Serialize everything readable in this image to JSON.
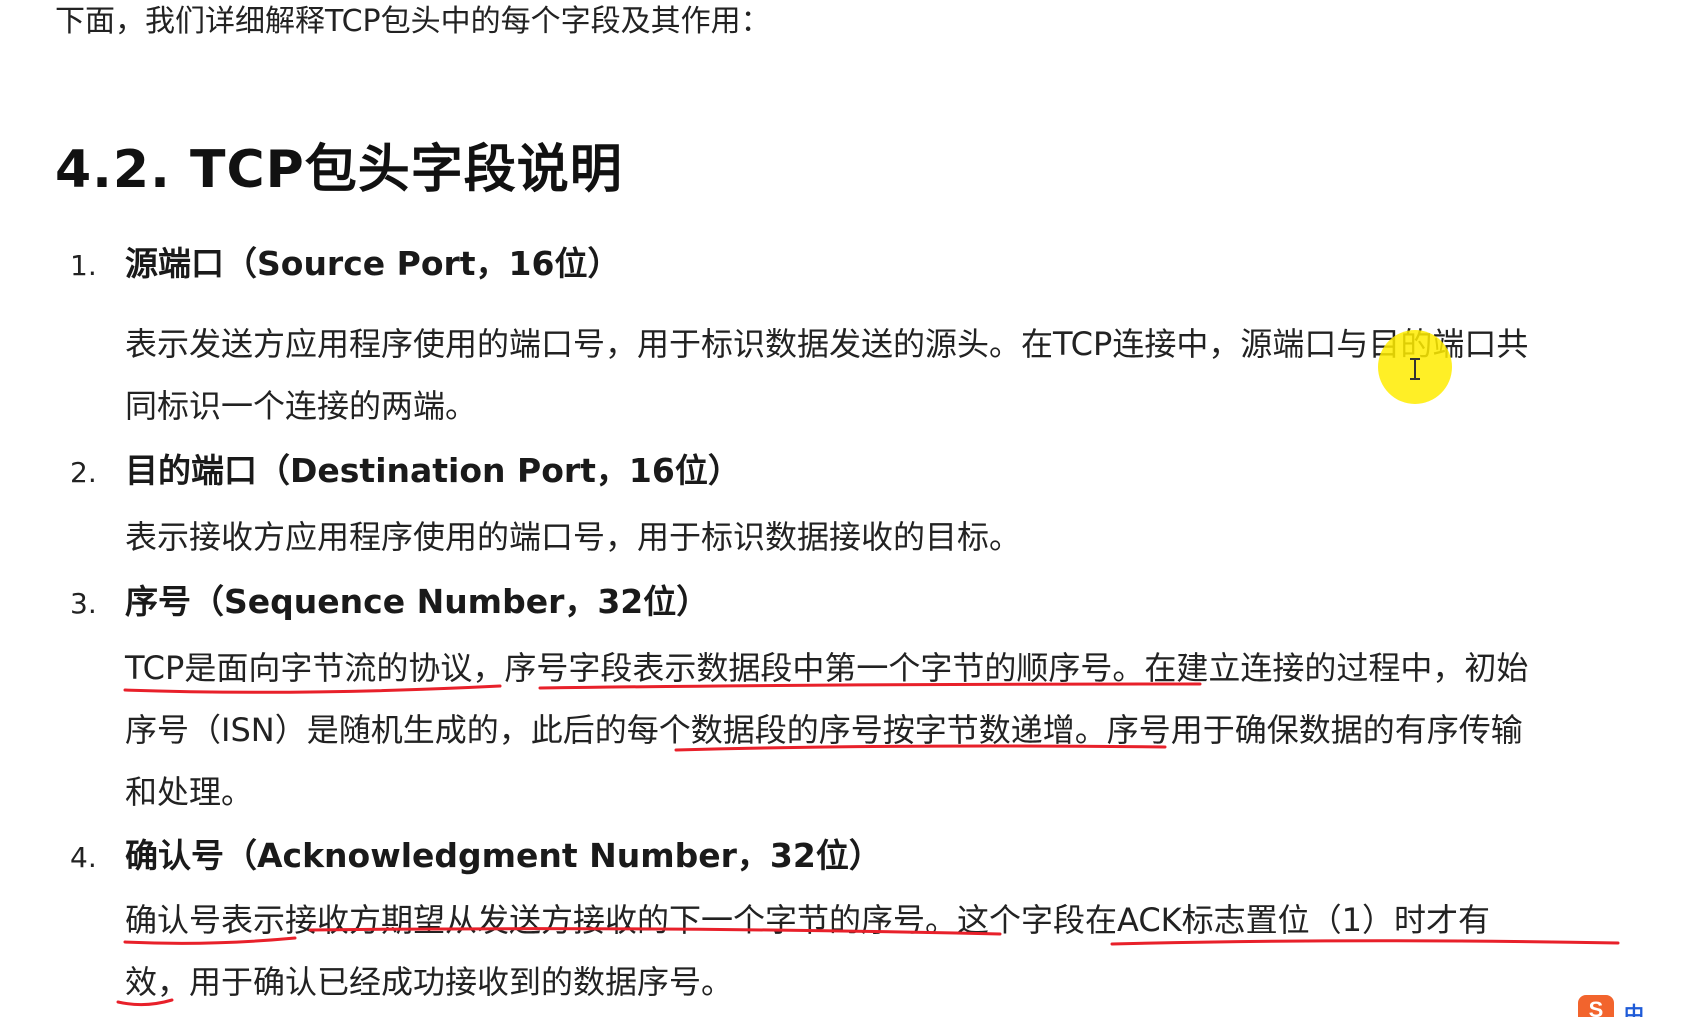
{
  "intro": "下面，我们详细解释TCP包头中的每个字段及其作用：",
  "heading": "4.2. TCP包头字段说明",
  "items": [
    {
      "num": "1.",
      "title": "源端口（Source Port，16位）",
      "lines": [
        "表示发送方应用程序使用的端口号，用于标识数据发送的源头。在TCP连接中，源端口与目的端口共",
        "同标识一个连接的两端。"
      ]
    },
    {
      "num": "2.",
      "title": "目的端口（Destination Port，16位）",
      "lines": [
        "表示接收方应用程序使用的端口号，用于标识数据接收的目标。"
      ]
    },
    {
      "num": "3.",
      "title": "序号（Sequence Number，32位）",
      "lines": [
        "TCP是面向字节流的协议，序号字段表示数据段中第一个字节的顺序号。在建立连接的过程中，初始",
        "序号（ISN）是随机生成的，此后的每个数据段的序号按字节数递增。序号用于确保数据的有序传输",
        "和处理。"
      ]
    },
    {
      "num": "4.",
      "title": "确认号（Acknowledgment Number，32位）",
      "lines": [
        "确认号表示接收方期望从发送方接收的下一个字节的序号。这个字段在ACK标志置位（1）时才有",
        "效，用于确认已经成功接收到的数据序号。"
      ]
    }
  ],
  "tray": {
    "icon_letter": "S",
    "label": "中"
  },
  "annotation_color": "#e8202a",
  "highlight_color": "#ffec00"
}
